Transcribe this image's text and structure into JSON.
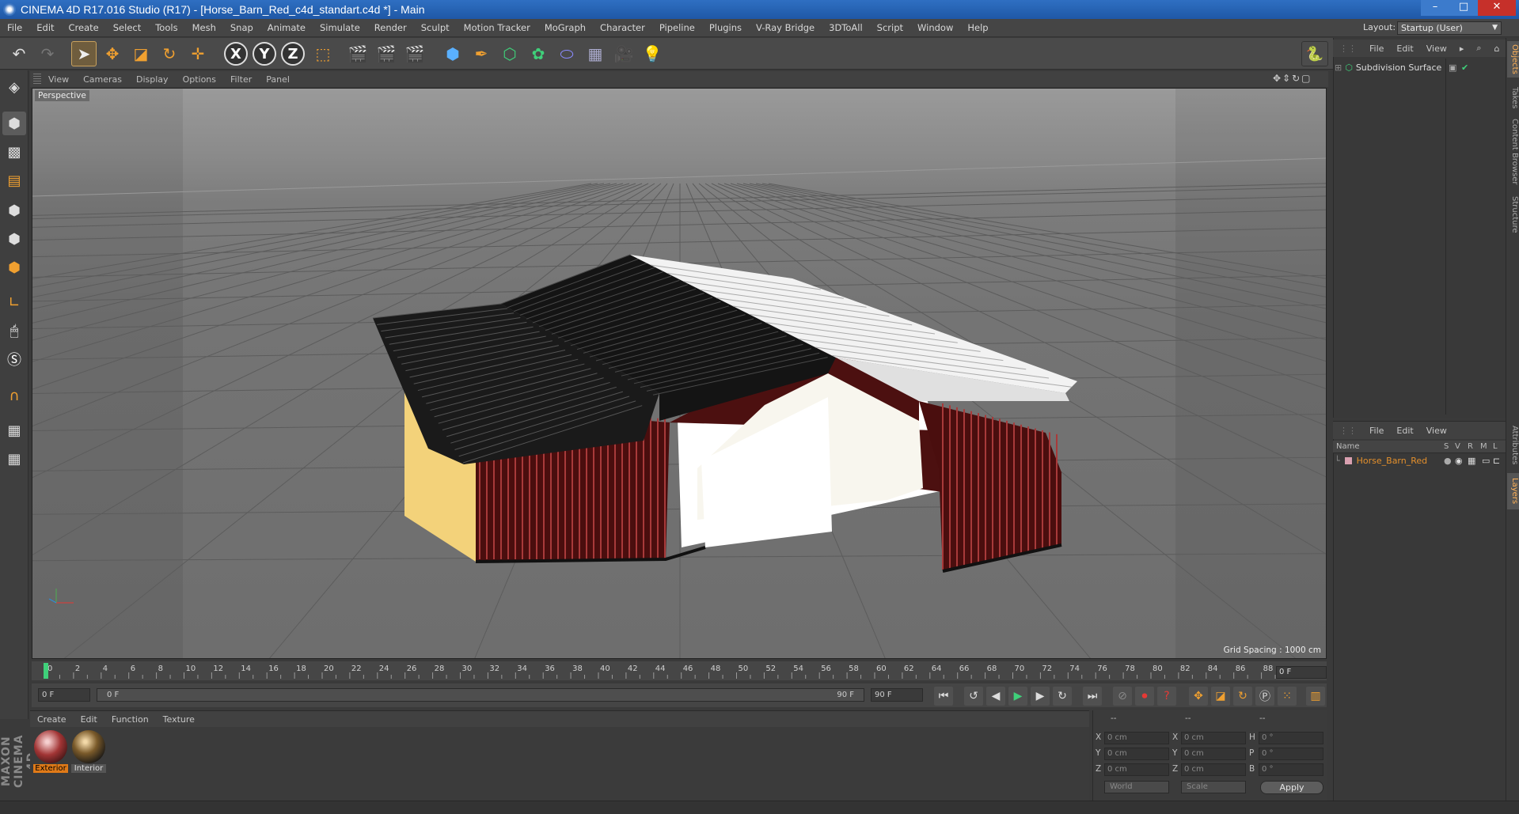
{
  "window": {
    "title": "CINEMA 4D R17.016 Studio (R17) - [Horse_Barn_Red_c4d_standart.c4d *] - Main",
    "min_glyph": "–",
    "max_glyph": "□",
    "close_glyph": "✕"
  },
  "menubar": {
    "items": [
      "File",
      "Edit",
      "Create",
      "Select",
      "Tools",
      "Mesh",
      "Snap",
      "Animate",
      "Simulate",
      "Render",
      "Sculpt",
      "Motion Tracker",
      "MoGraph",
      "Character",
      "Pipeline",
      "Plugins",
      "V-Ray Bridge",
      "3DToAll",
      "Script",
      "Window",
      "Help"
    ],
    "layout_label": "Layout:",
    "layout_value": "Startup (User)"
  },
  "toolbar": {
    "axis_x": "X",
    "axis_y": "Y",
    "axis_z": "Z"
  },
  "viewport": {
    "menu": [
      "View",
      "Cameras",
      "Display",
      "Options",
      "Filter",
      "Panel"
    ],
    "label": "Perspective",
    "grid_spacing": "Grid Spacing : 1000 cm",
    "nav_glyphs": "✥⇕↻▢"
  },
  "timeline": {
    "ticks": [
      "0",
      "2",
      "4",
      "6",
      "8",
      "10",
      "12",
      "14",
      "16",
      "18",
      "20",
      "22",
      "24",
      "26",
      "28",
      "30",
      "32",
      "34",
      "36",
      "38",
      "40",
      "42",
      "44",
      "46",
      "48",
      "50",
      "52",
      "54",
      "56",
      "58",
      "60",
      "62",
      "64",
      "66",
      "68",
      "70",
      "72",
      "74",
      "76",
      "78",
      "80",
      "82",
      "84",
      "86",
      "88",
      "90"
    ],
    "current_frame": "0 F",
    "start_field": "0 F",
    "range_start": "0 F",
    "range_end": "90 F",
    "end_field": "90 F"
  },
  "material_manager": {
    "menu": [
      "Create",
      "Edit",
      "Function",
      "Texture"
    ],
    "materials": [
      {
        "name": "Exterior"
      },
      {
        "name": "Interior"
      }
    ]
  },
  "coordinates": {
    "header": [
      "--",
      "--",
      "--"
    ],
    "rows": [
      {
        "a": "X",
        "av": "0 cm",
        "b": "X",
        "bv": "0 cm",
        "c": "H",
        "cv": "0 °"
      },
      {
        "a": "Y",
        "av": "0 cm",
        "b": "Y",
        "bv": "0 cm",
        "c": "P",
        "cv": "0 °"
      },
      {
        "a": "Z",
        "av": "0 cm",
        "b": "Z",
        "bv": "0 cm",
        "c": "B",
        "cv": "0 °"
      }
    ],
    "space": "World",
    "mode": "Scale",
    "apply": "Apply"
  },
  "object_manager": {
    "menu": [
      "File",
      "Edit",
      "View"
    ],
    "object": "Subdivision Surface"
  },
  "layer_manager": {
    "menu": [
      "File",
      "Edit",
      "View"
    ],
    "columns": [
      "Name",
      "S",
      "V",
      "R",
      "M",
      "L"
    ],
    "layer": "Horse_Barn_Red"
  },
  "side_tabs": [
    "Objects",
    "Takes",
    "Content Browser",
    "Structure",
    "Attributes",
    "Layers"
  ],
  "branding": "MAXON CINEMA 4D",
  "colors": {
    "accent_orange": "#e07a18",
    "titlebar_blue": "#2664b4",
    "barn_red": "#7a1616"
  }
}
